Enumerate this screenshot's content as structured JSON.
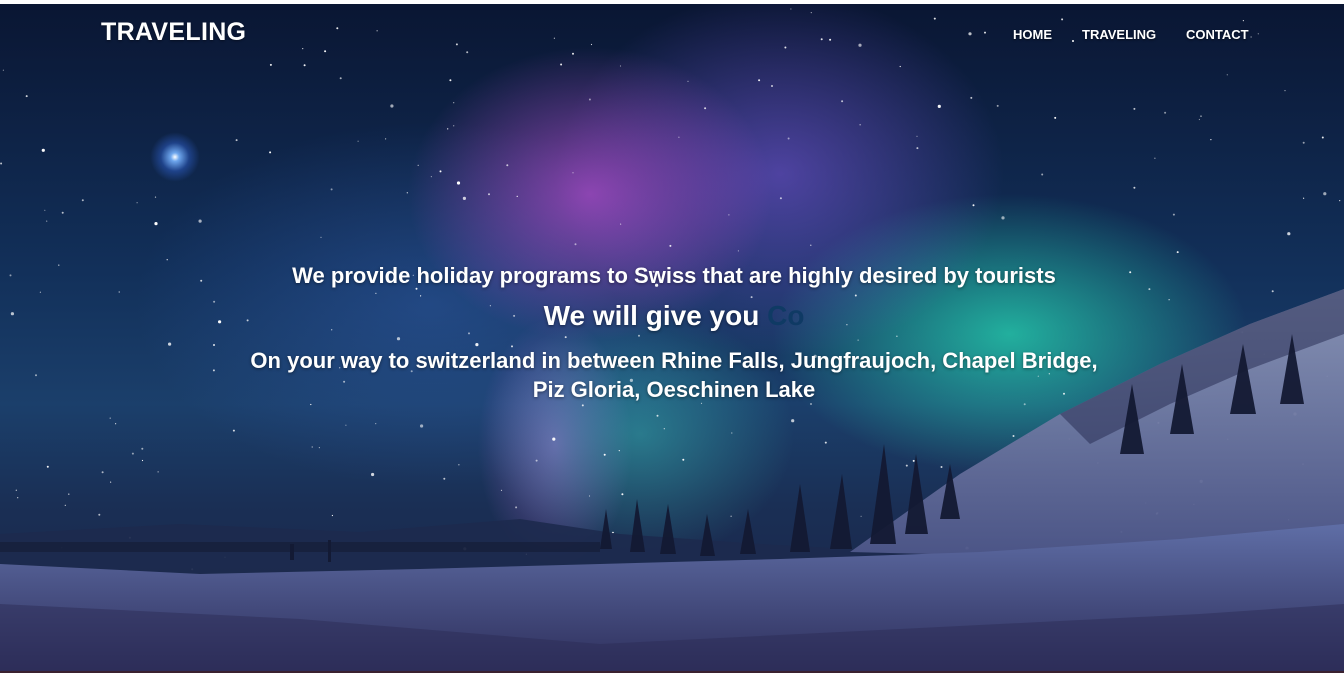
{
  "header": {
    "brand": "TRAVELING",
    "nav": [
      {
        "label": "HOME"
      },
      {
        "label": "TRAVELING"
      },
      {
        "label": "CONTACT"
      }
    ]
  },
  "hero": {
    "headline": "We provide holiday programs to Swiss that are highly desired by tourists",
    "tagline_text": "We will give you ",
    "tagline_accent": "Co",
    "route": "On your way to switzerland in between Rhine Falls, Jungfraujoch, Chapel Bridge, Piz Gloria, Oeschinen Lake"
  },
  "colors": {
    "text": "#ffffff",
    "accent": "#0f3a64",
    "sky_top": "#0a1633",
    "aurora_green": "#28f0be",
    "aurora_purple": "#c850dc",
    "snow": "#5b6aa0"
  }
}
